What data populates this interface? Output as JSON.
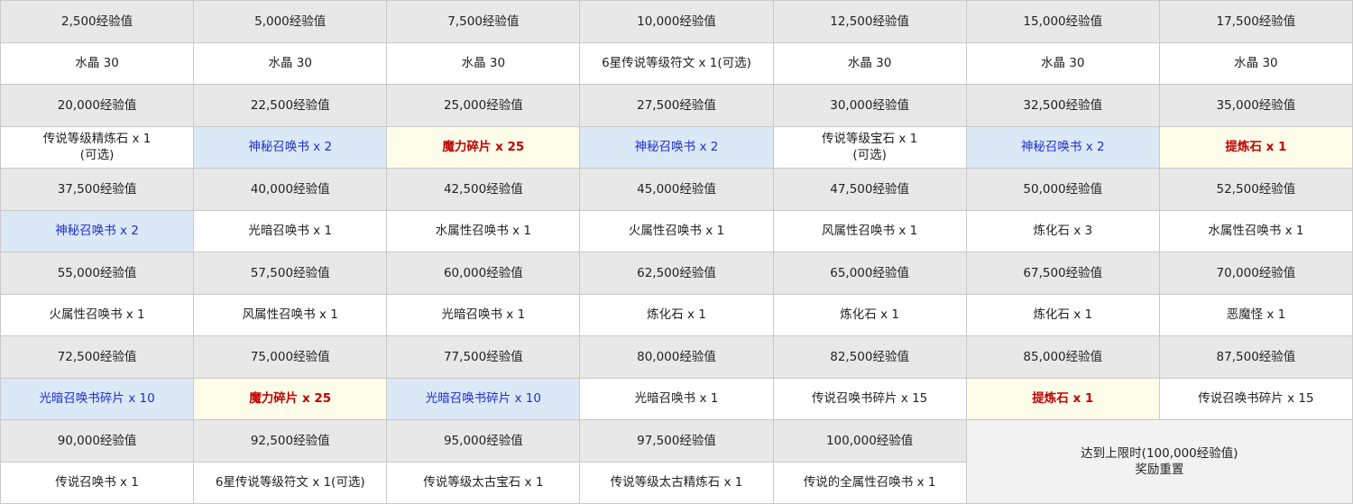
{
  "rows": [
    {
      "xp": [
        "2,500经验值",
        "5,000经验值",
        "7,500经验值",
        "10,000经验值",
        "12,500经验值",
        "15,000经验值",
        "17,500经验值"
      ],
      "rewards": [
        {
          "text": "水晶 30",
          "style": "normal"
        },
        {
          "text": "水晶 30",
          "style": "normal"
        },
        {
          "text": "水晶 30",
          "style": "normal"
        },
        {
          "text": "6星传说等级符文 x 1(可选)",
          "style": "normal"
        },
        {
          "text": "水晶 30",
          "style": "normal"
        },
        {
          "text": "水晶 30",
          "style": "normal"
        },
        {
          "text": "水晶 30",
          "style": "normal"
        }
      ]
    },
    {
      "xp": [
        "20,000经验值",
        "22,500经验值",
        "25,000经验值",
        "27,500经验值",
        "30,000经验值",
        "32,500经验值",
        "35,000经验值"
      ],
      "rewards": [
        {
          "text": "传说等级精炼石 x 1",
          "note": "(可选)",
          "style": "normal"
        },
        {
          "text": "神秘召唤书 x 2",
          "style": "blue"
        },
        {
          "text": "魔力碎片 x 25",
          "style": "yellow"
        },
        {
          "text": "神秘召唤书 x 2",
          "style": "blue"
        },
        {
          "text": "传说等级宝石 x 1",
          "note": "(可选)",
          "style": "normal"
        },
        {
          "text": "神秘召唤书 x 2",
          "style": "blue"
        },
        {
          "text": "提炼石 x 1",
          "style": "yellow"
        }
      ]
    },
    {
      "xp": [
        "37,500经验值",
        "40,000经验值",
        "42,500经验值",
        "45,000经验值",
        "47,500经验值",
        "50,000经验值",
        "52,500经验值"
      ],
      "rewards": [
        {
          "text": "神秘召唤书 x 2",
          "style": "blue"
        },
        {
          "text": "光暗召唤书 x 1",
          "style": "normal"
        },
        {
          "text": "水属性召唤书 x 1",
          "style": "normal"
        },
        {
          "text": "火属性召唤书 x 1",
          "style": "normal"
        },
        {
          "text": "风属性召唤书 x 1",
          "style": "normal"
        },
        {
          "text": "炼化石 x 3",
          "style": "normal"
        },
        {
          "text": "水属性召唤书 x 1",
          "style": "normal"
        }
      ]
    },
    {
      "xp": [
        "55,000经验值",
        "57,500经验值",
        "60,000经验值",
        "62,500经验值",
        "65,000经验值",
        "67,500经验值",
        "70,000经验值"
      ],
      "rewards": [
        {
          "text": "火属性召唤书 x 1",
          "style": "normal"
        },
        {
          "text": "风属性召唤书 x 1",
          "style": "normal"
        },
        {
          "text": "光暗召唤书 x 1",
          "style": "normal"
        },
        {
          "text": "炼化石 x 1",
          "style": "normal"
        },
        {
          "text": "炼化石 x 1",
          "style": "normal"
        },
        {
          "text": "炼化石 x 1",
          "style": "normal"
        },
        {
          "text": "恶魔怪 x 1",
          "style": "normal"
        }
      ]
    },
    {
      "xp": [
        "72,500经验值",
        "75,000经验值",
        "77,500经验值",
        "80,000经验值",
        "82,500经验值",
        "85,000经验值",
        "87,500经验值"
      ],
      "rewards": [
        {
          "text": "光暗召唤书碎片 x 10",
          "style": "blue"
        },
        {
          "text": "魔力碎片 x 25",
          "style": "yellow"
        },
        {
          "text": "光暗召唤书碎片 x 10",
          "style": "blue"
        },
        {
          "text": "光暗召唤书 x 1",
          "style": "normal"
        },
        {
          "text": "传说召唤书碎片 x 15",
          "style": "normal"
        },
        {
          "text": "提炼石 x 1",
          "style": "yellow"
        },
        {
          "text": "传说召唤书碎片 x 15",
          "style": "normal"
        }
      ]
    },
    {
      "xp": [
        "90,000经验值",
        "92,500经验值",
        "95,000经验值",
        "97,500经验值",
        "100,000经验值"
      ],
      "rewards": [
        {
          "text": "传说召唤书 x 1",
          "style": "normal"
        },
        {
          "text": "6星传说等级符文 x 1(可选)",
          "style": "normal"
        },
        {
          "text": "传说等级太古宝石 x 1",
          "style": "normal"
        },
        {
          "text": "传说等级太古精炼石 x 1",
          "style": "normal"
        },
        {
          "text": "传说的全属性召唤书 x 1",
          "style": "normal"
        }
      ]
    }
  ],
  "final_note": {
    "line1": "达到上限时(100,000经验值)",
    "line2": "奖励重置"
  }
}
